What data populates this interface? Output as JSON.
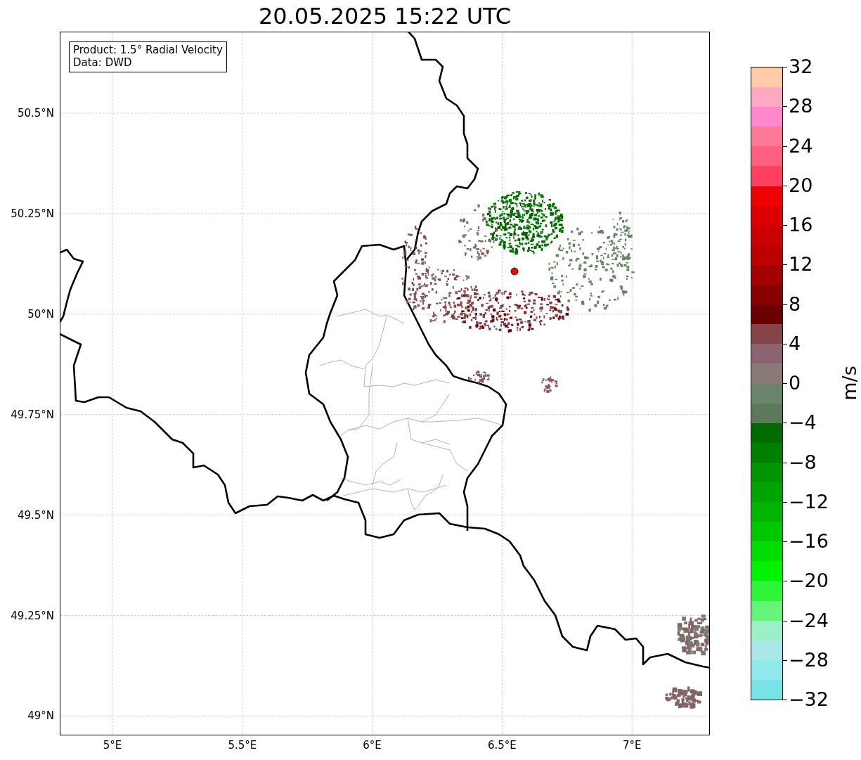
{
  "title": "20.05.2025 15:22 UTC",
  "info_box": {
    "lines": [
      "Product: 1.5° Radial Velocity",
      "Data: DWD"
    ]
  },
  "map": {
    "x_ticks": [
      "5°E",
      "5.5°E",
      "6°E",
      "6.5°E",
      "7°E"
    ],
    "y_ticks": [
      "50.5°N",
      "50.25°N",
      "50°N",
      "49.75°N",
      "49.5°N",
      "49.25°N",
      "49°N"
    ]
  },
  "colorbar": {
    "label": "m/s",
    "ticks": [
      "32",
      "28",
      "24",
      "20",
      "16",
      "12",
      "8",
      "4",
      "0",
      "−4",
      "−8",
      "−12",
      "−16",
      "−20",
      "−24",
      "−28",
      "−32"
    ],
    "segments": [
      {
        "color": "#ffccaa"
      },
      {
        "color": "#ffa8c4"
      },
      {
        "color": "#ff88cc"
      },
      {
        "color": "#ff7898"
      },
      {
        "color": "#ff6080"
      },
      {
        "color": "#ff4060"
      },
      {
        "color": "#f00000"
      },
      {
        "color": "#dc0000"
      },
      {
        "color": "#cc0000"
      },
      {
        "color": "#bc0000"
      },
      {
        "color": "#a40000"
      },
      {
        "color": "#880000"
      },
      {
        "color": "#6a0000"
      },
      {
        "color": "#844448"
      },
      {
        "color": "#8a6470"
      },
      {
        "color": "#8a7a76"
      },
      {
        "color": "#6a846a"
      },
      {
        "color": "#5a7a5a"
      },
      {
        "color": "#006c00"
      },
      {
        "color": "#008000"
      },
      {
        "color": "#009400"
      },
      {
        "color": "#00a400"
      },
      {
        "color": "#00b400"
      },
      {
        "color": "#00c800"
      },
      {
        "color": "#00dc00"
      },
      {
        "color": "#00f400"
      },
      {
        "color": "#2ef43a"
      },
      {
        "color": "#66f47a"
      },
      {
        "color": "#9cf0c8"
      },
      {
        "color": "#aae8ec"
      },
      {
        "color": "#8ee8ec"
      },
      {
        "color": "#78e4e8"
      }
    ]
  }
}
